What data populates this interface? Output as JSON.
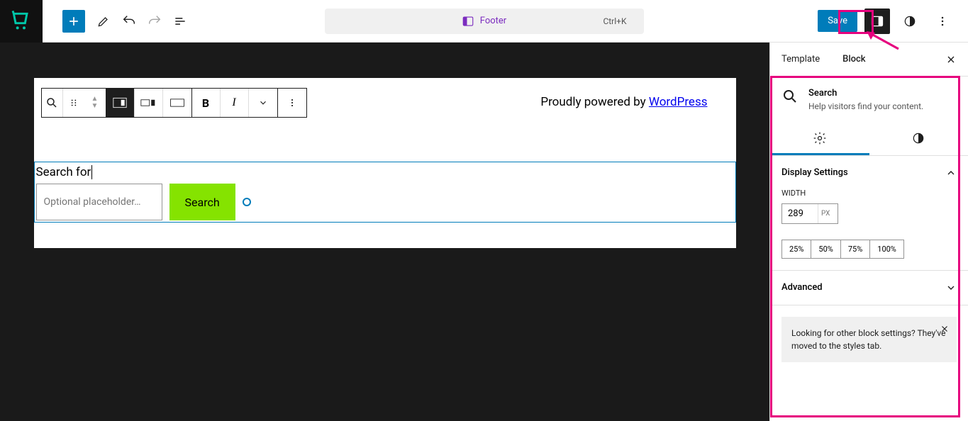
{
  "topbar": {
    "center_label": "Footer",
    "shortcut": "Ctrl+K",
    "save_label": "Save"
  },
  "canvas": {
    "powered_prefix": "Proudly powered by ",
    "powered_link": "WordPress",
    "search_label": "Search for",
    "search_placeholder": "Optional placeholder…",
    "search_button": "Search"
  },
  "sidebar": {
    "tabs": {
      "template": "Template",
      "block": "Block"
    },
    "block_title": "Search",
    "block_desc": "Help visitors find your content.",
    "display_settings_title": "Display Settings",
    "width_label": "WIDTH",
    "width_value": "289",
    "width_unit": "PX",
    "pct": [
      "25%",
      "50%",
      "75%",
      "100%"
    ],
    "advanced_title": "Advanced",
    "notice_text": "Looking for other block settings? They've moved to the styles tab."
  }
}
